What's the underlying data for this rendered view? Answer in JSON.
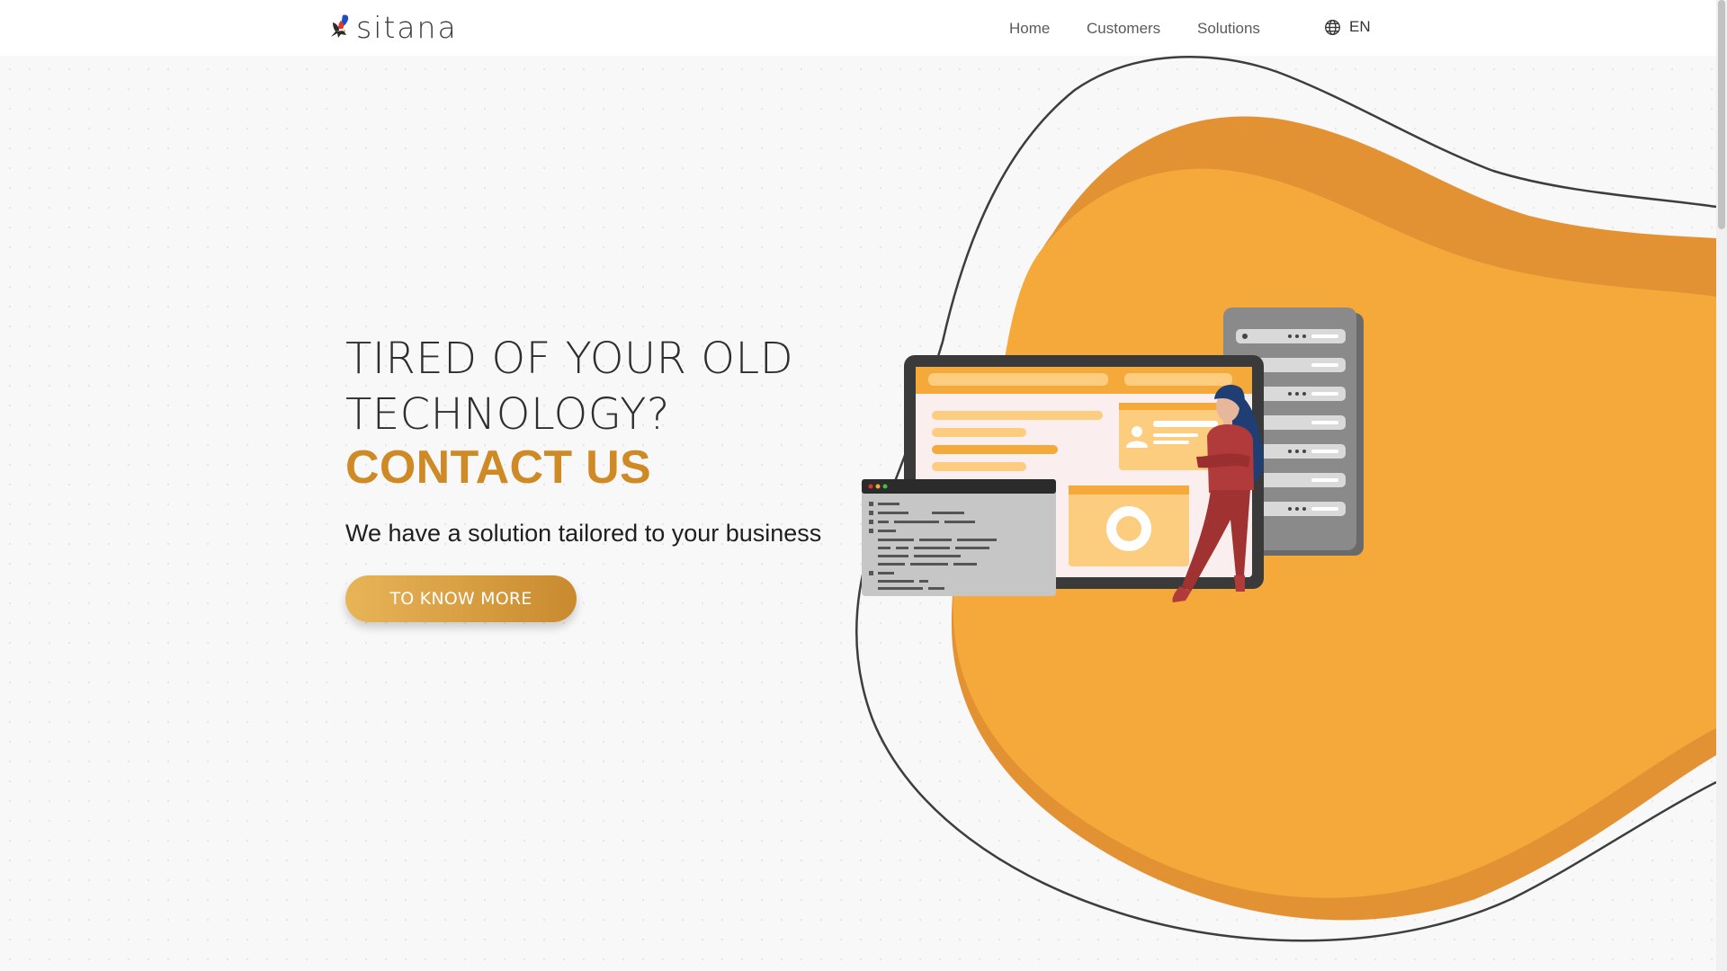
{
  "brand": {
    "name": "sitana"
  },
  "nav": {
    "items": [
      {
        "label": "Home"
      },
      {
        "label": "Customers"
      },
      {
        "label": "Solutions"
      }
    ],
    "language": "EN"
  },
  "hero": {
    "title_line1": "TIRED OF YOUR OLD",
    "title_line2": "TECHNOLOGY?",
    "cta_title": "CONTACT US",
    "subtitle": "We have a solution tailored to your business",
    "button_label": "TO KNOW MORE"
  },
  "colors": {
    "accent": "#cf8a26",
    "blob": "#f5a93a",
    "blob_shadow": "#e39233",
    "outline": "#3d3d3d"
  },
  "icons": {
    "language": "globe-icon"
  }
}
